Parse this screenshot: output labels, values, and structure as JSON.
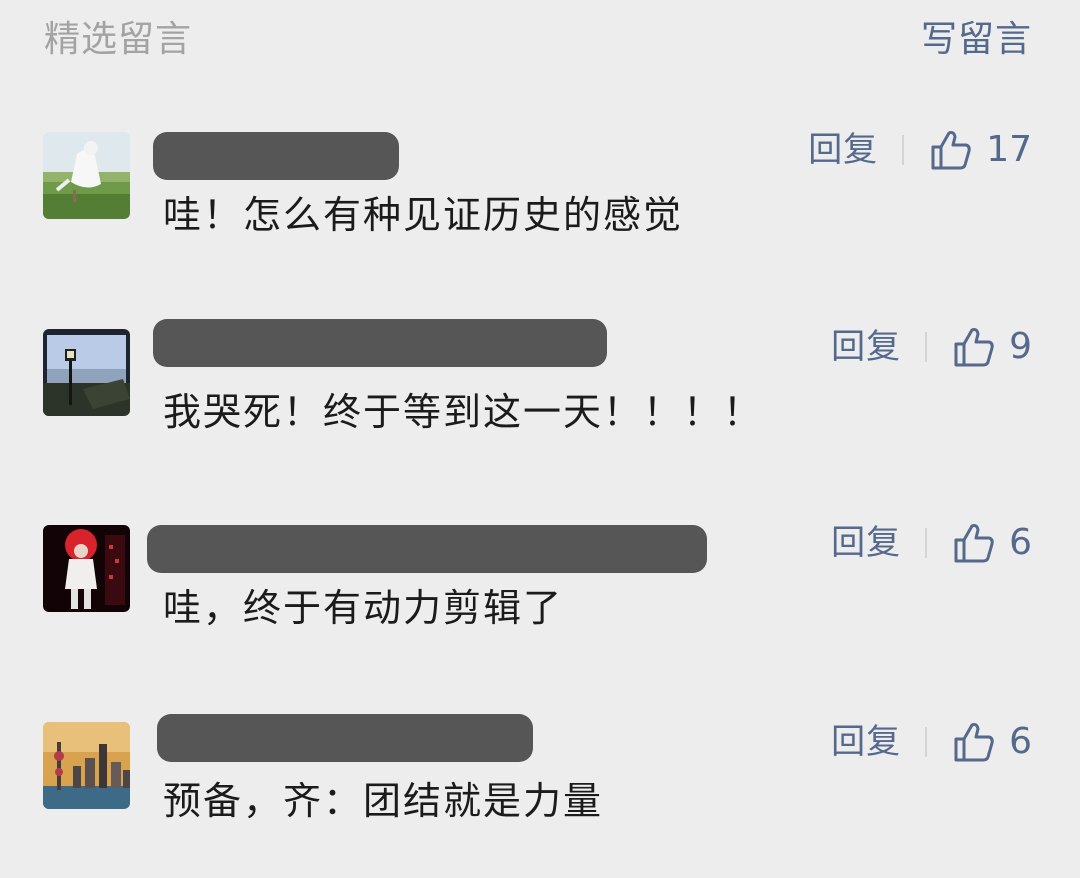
{
  "header": {
    "title": "精选留言",
    "write_label": "写留言"
  },
  "comments": [
    {
      "text": "哇！怎么有种见证历史的感觉",
      "reply_label": "回复",
      "likes": "17"
    },
    {
      "text": "我哭死！终于等到这一天！！！！",
      "reply_label": "回复",
      "likes": "9"
    },
    {
      "text": "哇，终于有动力剪辑了",
      "reply_label": "回复",
      "likes": "6"
    },
    {
      "text": "预备，齐：团结就是力量",
      "reply_label": "回复",
      "likes": "6"
    }
  ],
  "colors": {
    "background": "#ededed",
    "link_blue": "#55698c",
    "muted_gray": "#a3a3a3",
    "redaction_bar": "#565656",
    "text": "#1b1b1b"
  },
  "icons": {
    "like": "thumbs-up-icon"
  }
}
